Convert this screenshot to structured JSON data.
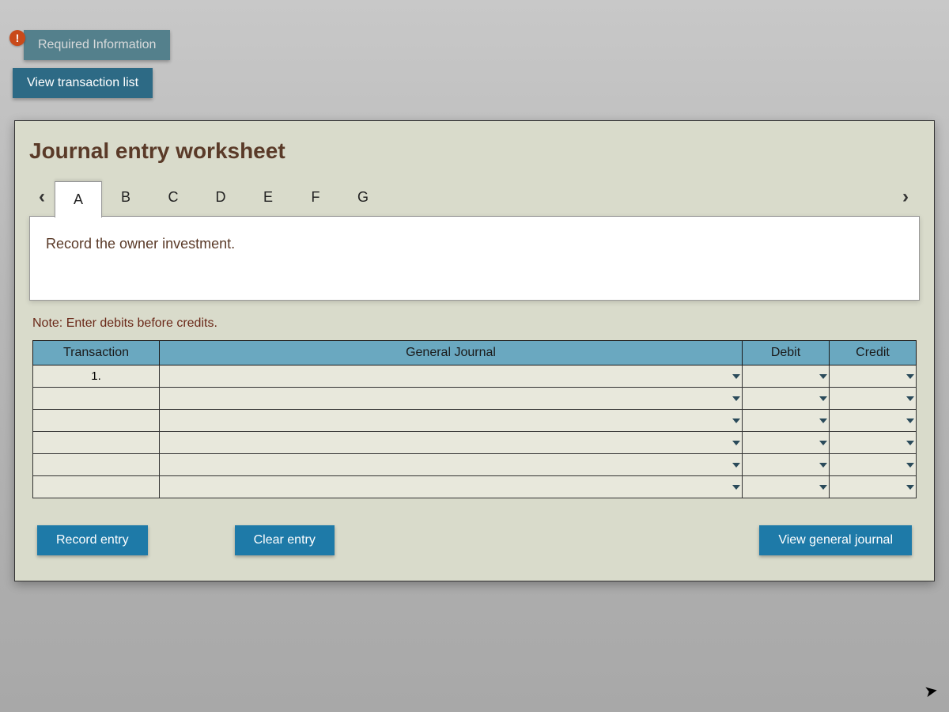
{
  "topTabs": {
    "required": "Required Information",
    "viewList": "View transaction list"
  },
  "worksheet": {
    "title": "Journal entry worksheet",
    "tabs": [
      "A",
      "B",
      "C",
      "D",
      "E",
      "F",
      "G"
    ],
    "activeTab": "A",
    "instruction": "Record the owner investment.",
    "note": "Note: Enter debits before credits.",
    "columns": {
      "transaction": "Transaction",
      "generalJournal": "General Journal",
      "debit": "Debit",
      "credit": "Credit"
    },
    "rows": [
      {
        "transaction": "1.",
        "gj": "",
        "debit": "",
        "credit": ""
      },
      {
        "transaction": "",
        "gj": "",
        "debit": "",
        "credit": ""
      },
      {
        "transaction": "",
        "gj": "",
        "debit": "",
        "credit": ""
      },
      {
        "transaction": "",
        "gj": "",
        "debit": "",
        "credit": ""
      },
      {
        "transaction": "",
        "gj": "",
        "debit": "",
        "credit": ""
      },
      {
        "transaction": "",
        "gj": "",
        "debit": "",
        "credit": ""
      }
    ],
    "buttons": {
      "record": "Record entry",
      "clear": "Clear entry",
      "viewJournal": "View general journal"
    }
  },
  "badge": "!"
}
